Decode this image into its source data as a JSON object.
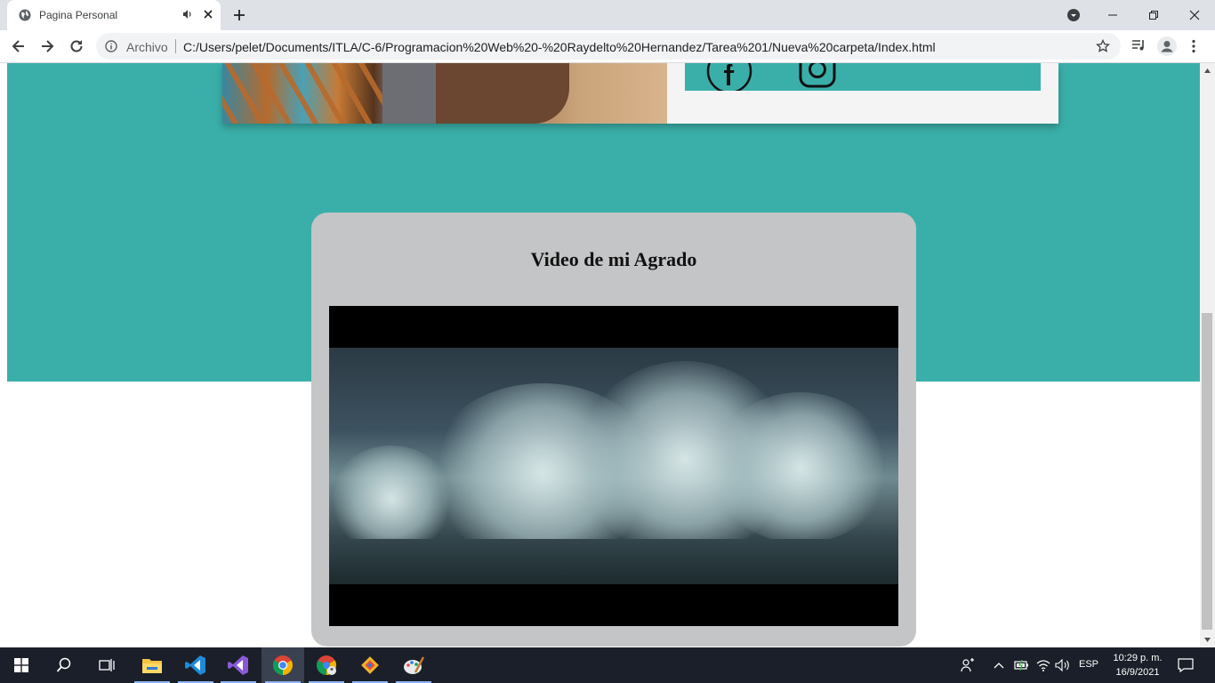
{
  "browser": {
    "tab": {
      "title": "Pagina Personal"
    },
    "address": {
      "security_label": "Archivo",
      "url": "C:/Users/pelet/Documents/ITLA/C-6/Programacion%20Web%20-%20Raydelto%20Hernandez/Tarea%201/Nueva%20carpeta/Index.html"
    }
  },
  "page": {
    "video_section": {
      "title": "Video de mi Agrado"
    },
    "colors": {
      "teal": "#3aafa9",
      "card_gray": "#c4c5c7",
      "social_card": "#f4f4f4"
    },
    "social_icons": [
      "facebook-icon",
      "instagram-icon"
    ]
  },
  "taskbar": {
    "apps": [
      "start",
      "search",
      "task-view",
      "file-explorer",
      "vscode",
      "visual-studio",
      "chrome",
      "chrome-profile",
      "git",
      "paint"
    ],
    "tray": {
      "language": "ESP",
      "time": "10:29 p. m.",
      "date": "16/9/2021"
    }
  }
}
